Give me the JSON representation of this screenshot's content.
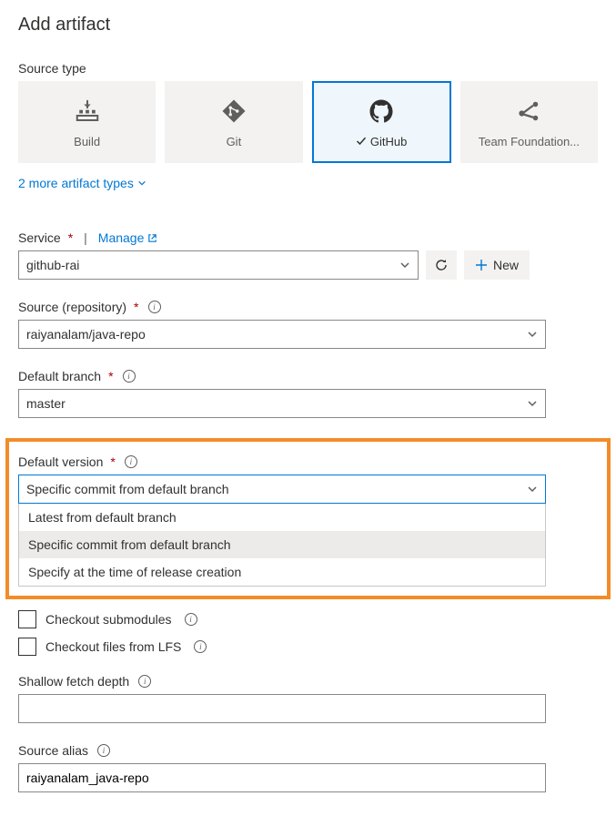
{
  "title": "Add artifact",
  "sourceType": {
    "label": "Source type",
    "tiles": [
      {
        "label": "Build",
        "selected": false
      },
      {
        "label": "Git",
        "selected": false
      },
      {
        "label": "GitHub",
        "selected": true
      },
      {
        "label": "Team Foundation...",
        "selected": false
      }
    ],
    "moreLink": "2 more artifact types"
  },
  "service": {
    "label": "Service",
    "manageLabel": "Manage",
    "value": "github-rai",
    "newLabel": "New"
  },
  "repository": {
    "label": "Source (repository)",
    "value": "raiyanalam/java-repo"
  },
  "defaultBranch": {
    "label": "Default branch",
    "value": "master"
  },
  "defaultVersion": {
    "label": "Default version",
    "value": "Specific commit from default branch",
    "options": [
      "Latest from default branch",
      "Specific commit from default branch",
      "Specify at the time of release creation"
    ]
  },
  "checkboxes": {
    "submodules": "Checkout submodules",
    "lfs": "Checkout files from LFS"
  },
  "shallowFetch": {
    "label": "Shallow fetch depth",
    "value": ""
  },
  "sourceAlias": {
    "label": "Source alias",
    "value": "raiyanalam_java-repo"
  }
}
